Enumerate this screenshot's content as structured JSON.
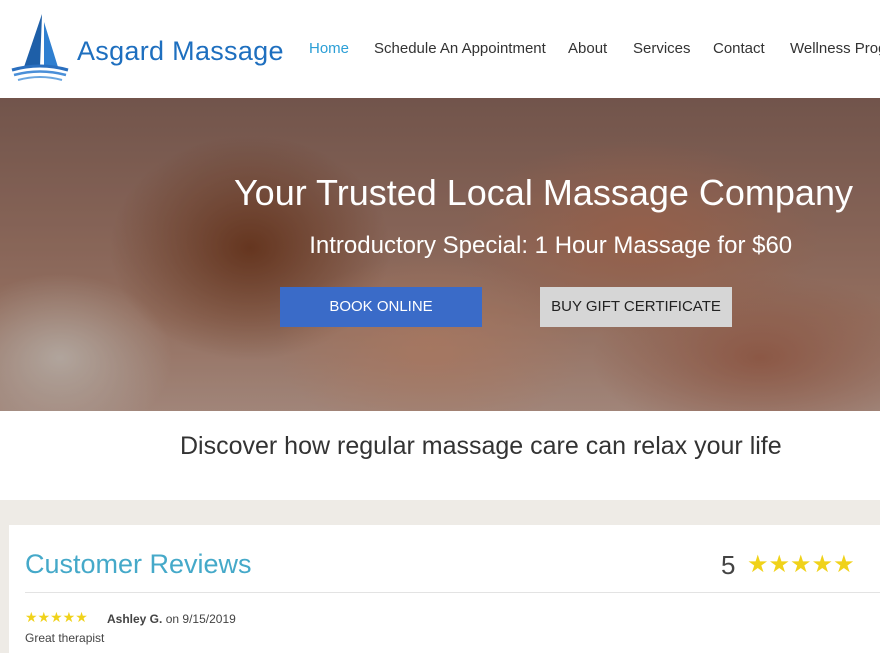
{
  "header": {
    "brand": "Asgard Massage",
    "nav": [
      {
        "label": "Home",
        "active": true
      },
      {
        "label": "Schedule An Appointment",
        "active": false
      },
      {
        "label": "About",
        "active": false
      },
      {
        "label": "Services",
        "active": false
      },
      {
        "label": "Contact",
        "active": false
      },
      {
        "label": "Wellness Prog",
        "active": false
      }
    ]
  },
  "hero": {
    "title": "Your Trusted Local Massage Company",
    "subtitle": "Introductory Special: 1 Hour Massage for $60",
    "book_button": "BOOK ONLINE",
    "gift_button": "BUY GIFT CERTIFICATE"
  },
  "tagline": "Discover how regular massage care can relax your life",
  "reviews": {
    "title": "Customer Reviews",
    "rating": "5",
    "stars": "★★★★★",
    "items": [
      {
        "stars": "★★★★★",
        "author": "Ashley G.",
        "date_prefix": "on",
        "date": "9/15/2019",
        "text": "Great therapist"
      }
    ]
  },
  "colors": {
    "brand": "#1e6fbf",
    "nav_active": "#2c9fd6",
    "book_button": "#3a6bc8",
    "gift_button": "#d6d6d6",
    "reviews_title": "#45a9c9",
    "star": "#f0d21a"
  },
  "icons": {
    "logo": "sailboat-logo-icon",
    "star": "star-icon"
  }
}
